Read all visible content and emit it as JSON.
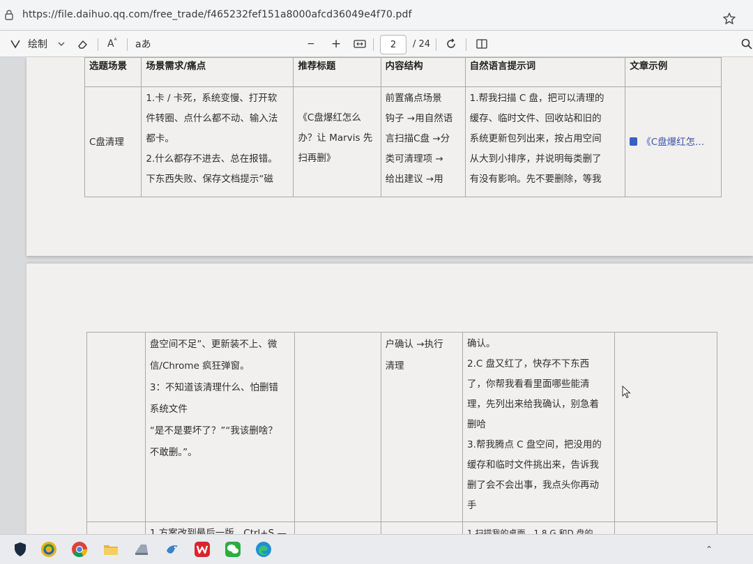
{
  "browser": {
    "url": "https://file.daihuo.qq.com/free_trade/f465232fef151a8000afcd36049e4f70.pdf"
  },
  "toolbar": {
    "draw_label": "绘制",
    "text_label": "A",
    "read_label": "aあ",
    "zoom_out": "−",
    "zoom_in": "+",
    "current_page": "2",
    "total_pages": "/ 24"
  },
  "table": {
    "headers": [
      "选题场景",
      "场景需求/痛点",
      "推荐标题",
      "内容结构",
      "自然语言提示词",
      "文章示例"
    ],
    "row1": {
      "scene": "C盘清理",
      "need": [
        "1.卡 / 卡死，系统变慢、打开软",
        "件转圈、点什么都不动、输入法",
        "都卡。",
        "2.什么都存不进去、总在报错。",
        "下东西失败、保存文档提示“磁"
      ],
      "title": [
        "《C盘爆红怎么",
        "办？让 Marvis 先",
        "扫再删》"
      ],
      "structure": [
        "前置痛点场景",
        "钩子 →用自然语",
        "言扫描C盘 →分",
        "类可清理项 →",
        "给出建议 →用"
      ],
      "prompt": [
        "1.帮我扫描 C 盘，把可以清理的",
        "缓存、临时文件、回收站和旧的",
        "系统更新包列出来，按占用空间",
        "从大到小排序，并说明每类删了",
        "有没有影响。先不要删除，等我"
      ],
      "example": "《C盘爆红怎..."
    },
    "row2": {
      "need": [
        "盘空间不足”、更新装不上、微",
        "信/Chrome 疯狂弹窗。",
        "3：不知道该清理什么、怕删错",
        "系统文件",
        "“是不是要坏了？”“我该删啥？",
        "不敢删。”。"
      ],
      "structure": [
        "户确认 →执行",
        "清理"
      ],
      "prompt": [
        "确认。",
        "2.C 盘又红了，快存不下东西",
        "了，你帮我看看里面哪些能清",
        "理，先列出来给我确认，别急着",
        "删哈",
        "3.帮我腾点 C 盘空间，把没用的",
        "缓存和临时文件挑出来，告诉我",
        "删了会不会出事，我点头你再动",
        "手"
      ]
    },
    "row3": {
      "need": "1.方案改到最后一版，Ctrl+S —",
      "prompt": "1.扫描我的桌面，1.8 G 和D 盘的"
    }
  },
  "taskbar": {
    "icons": [
      "shield-icon",
      "swirl-app-icon",
      "chrome-icon",
      "folder-icon",
      "bird-app-icon",
      "fan-app-icon",
      "wps-icon",
      "wechat-icon",
      "edge-icon"
    ]
  },
  "colors": {
    "link": "#3d56a8",
    "wps": "#d8262c",
    "wechat": "#2aae3d"
  }
}
